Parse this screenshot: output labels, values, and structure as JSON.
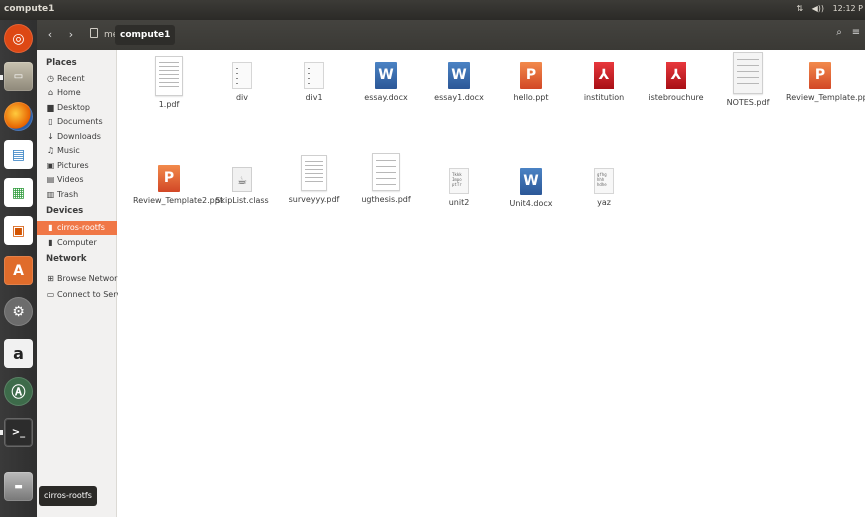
{
  "top_panel": {
    "title": "compute1",
    "network_icon": "network-transfer-icon",
    "volume_icon": "volume-icon",
    "clock": "12:12 P"
  },
  "launcher": {
    "items": [
      {
        "name": "dash-home",
        "icon": "ubuntu-logo-icon",
        "color": "#dd4814"
      },
      {
        "name": "files",
        "icon": "file-cabinet-icon",
        "color": "#a09a8a"
      },
      {
        "name": "firefox",
        "icon": "firefox-icon",
        "color": "#e66000"
      },
      {
        "name": "libreoffice-writer",
        "icon": "writer-icon",
        "color": "#2b7bc0"
      },
      {
        "name": "libreoffice-calc",
        "icon": "calc-icon",
        "color": "#2e9b3b"
      },
      {
        "name": "libreoffice-impress",
        "icon": "impress-icon",
        "color": "#d35400"
      },
      {
        "name": "software-center",
        "icon": "software-center-icon",
        "color": "#e06c2b"
      },
      {
        "name": "system-settings",
        "icon": "settings-gear-icon",
        "color": "#777"
      },
      {
        "name": "amazon",
        "icon": "amazon-icon",
        "color": "#f1f1f1"
      },
      {
        "name": "software-updater",
        "icon": "updater-icon",
        "color": "#5a5a5a"
      },
      {
        "name": "terminal",
        "icon": "terminal-icon",
        "color": "#2c2c2c"
      },
      {
        "name": "cirros-rootfs",
        "icon": "drive-icon",
        "color": "#888"
      }
    ]
  },
  "toolbar": {
    "back": "‹",
    "forward": "›",
    "breadcrumb_parent": "media",
    "breadcrumb_current": "compute1",
    "search_icon": "search-icon",
    "menu_icon": "hamburger-menu-icon"
  },
  "sidebar": {
    "places_header": "Places",
    "places": [
      {
        "label": "Recent",
        "icon": "clock-icon",
        "glyph": "◷"
      },
      {
        "label": "Home",
        "icon": "home-icon",
        "glyph": "⌂"
      },
      {
        "label": "Desktop",
        "icon": "desktop-icon",
        "glyph": "▆"
      },
      {
        "label": "Documents",
        "icon": "document-icon",
        "glyph": "▯"
      },
      {
        "label": "Downloads",
        "icon": "download-icon",
        "glyph": "↓"
      },
      {
        "label": "Music",
        "icon": "music-icon",
        "glyph": "♫"
      },
      {
        "label": "Pictures",
        "icon": "pictures-icon",
        "glyph": "▣"
      },
      {
        "label": "Videos",
        "icon": "videos-icon",
        "glyph": "▤"
      },
      {
        "label": "Trash",
        "icon": "trash-icon",
        "glyph": "▥"
      }
    ],
    "devices_header": "Devices",
    "devices": [
      {
        "label": "cirros-rootfs",
        "icon": "drive-icon",
        "glyph": "▮",
        "selected": true
      },
      {
        "label": "Computer",
        "icon": "computer-icon",
        "glyph": "▮",
        "selected": false
      }
    ],
    "network_header": "Network",
    "network": [
      {
        "label": "Browse Network",
        "icon": "network-icon",
        "glyph": "⊞"
      },
      {
        "label": "Connect to Server",
        "icon": "server-icon",
        "glyph": "▭"
      }
    ]
  },
  "files": [
    {
      "name": "1.pdf",
      "type": "pdf-page"
    },
    {
      "name": "div",
      "type": "text"
    },
    {
      "name": "div1",
      "type": "text"
    },
    {
      "name": "essay.docx",
      "type": "word"
    },
    {
      "name": "essay1.docx",
      "type": "word"
    },
    {
      "name": "hello.ppt",
      "type": "ppt"
    },
    {
      "name": "institution",
      "type": "pdf"
    },
    {
      "name": "istebrouchure",
      "type": "pdf"
    },
    {
      "name": "NOTES.pdf",
      "type": "pdf-page"
    },
    {
      "name": "Review_Template.ppt",
      "type": "ppt"
    },
    {
      "name": "Review_Template2.ppt",
      "type": "ppt"
    },
    {
      "name": "SkipList.class",
      "type": "java"
    },
    {
      "name": "surveyyy.pdf",
      "type": "pdf-page"
    },
    {
      "name": "ugthesis.pdf",
      "type": "pdf-page"
    },
    {
      "name": "unit2",
      "type": "script"
    },
    {
      "name": "Unit4.docx",
      "type": "word"
    },
    {
      "name": "yaz",
      "type": "script"
    }
  ],
  "tooltip": "cirros-rootfs"
}
